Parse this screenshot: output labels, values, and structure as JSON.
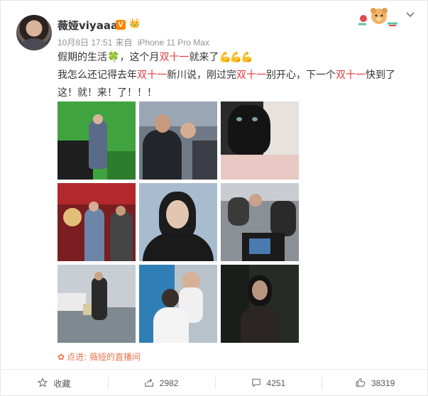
{
  "post": {
    "username": "薇娅viyaaa",
    "verified_badge": "V",
    "vip_badge": "👑",
    "date": "10月8日 17:51",
    "device_prefix": "来自",
    "device": "iPhone 11 Pro Max",
    "line1_a": "假期的生活",
    "line1_b": "，这个月",
    "line1_hl": "双十一",
    "line1_c": "就来了",
    "line1_emoji": "💪💪💪",
    "line2_a": "我怎么还记得去年",
    "line2_hl1": "双十一",
    "line2_b": "新川说，刚过完",
    "line2_hl2": "双十一",
    "line2_c": "别开心，下一个",
    "line2_hl3": "双十一",
    "line2_d": "快到了",
    "line3": "这！就！来！了！！！",
    "clover_emoji": "🍀"
  },
  "source": {
    "prefix": "点进:",
    "name": "薇娅的直播间"
  },
  "actions": {
    "favorite_label": "收藏",
    "share_count": "2982",
    "comment_count": "4251",
    "like_count": "38319"
  },
  "icons": {
    "more": "chevron-down-icon",
    "favorite": "star-icon",
    "share": "share-icon",
    "comment": "comment-icon",
    "like": "thumbs-up-icon",
    "source": "flower-icon"
  },
  "colors": {
    "highlight": "#e5383b",
    "source_link": "#eb7350",
    "badge_orange": "#ff8200",
    "meta_gray": "#939393"
  }
}
